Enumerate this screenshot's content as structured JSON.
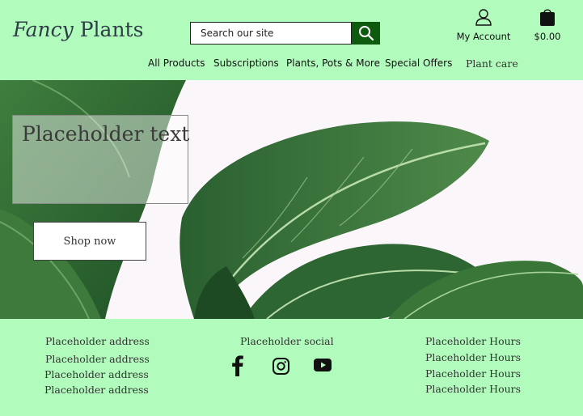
{
  "header": {
    "logo_italic": "Fancy",
    "logo_regular": "Plants",
    "search_placeholder": "Search our site",
    "account_label": "My Account",
    "cart_total": "$0.00"
  },
  "nav": {
    "items": [
      "All Products",
      "Subscriptions",
      "Plants, Pots & More",
      "Special Offers",
      "Plant care"
    ]
  },
  "hero": {
    "placeholder_text": "Placeholder text",
    "cta_label": "Shop now"
  },
  "footer": {
    "address_lines": [
      "Placeholder address",
      "Placeholder address",
      "Placeholder address",
      "Placeholder address"
    ],
    "social_title": "Placeholder social",
    "social_icons": [
      "facebook-icon",
      "instagram-icon",
      "youtube-icon"
    ],
    "hours_lines": [
      "Placeholder Hours",
      "Placeholder Hours",
      "Placeholder Hours",
      "Placeholder Hours"
    ]
  },
  "colors": {
    "background": "#b1fbbc",
    "search_button": "#0e5a0e",
    "leaf_dark": "#1f4f25",
    "leaf_light": "#4f8a4a"
  }
}
